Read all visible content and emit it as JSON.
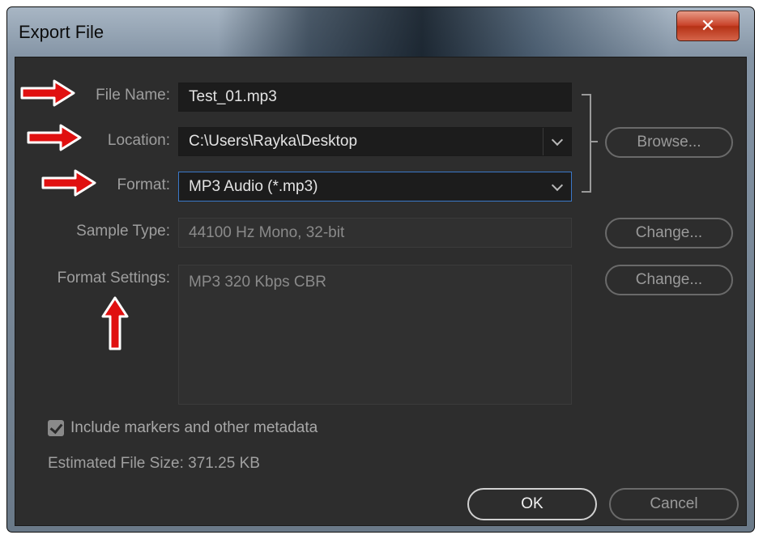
{
  "window": {
    "title": "Export File",
    "close_glyph": "✕"
  },
  "fields": {
    "file_name": {
      "label": "File Name:",
      "value": "Test_01.mp3"
    },
    "location": {
      "label": "Location:",
      "value": "C:\\Users\\Rayka\\Desktop"
    },
    "format": {
      "label": "Format:",
      "value": "MP3 Audio (*.mp3)"
    },
    "sample_type": {
      "label": "Sample Type:",
      "value": "44100 Hz Mono, 32-bit"
    },
    "format_settings": {
      "label": "Format Settings:",
      "value": "MP3 320 Kbps CBR"
    }
  },
  "buttons": {
    "browse": "Browse...",
    "change_sample": "Change...",
    "change_format": "Change...",
    "ok": "OK",
    "cancel": "Cancel"
  },
  "options": {
    "include_markers_label": "Include markers and other metadata",
    "include_markers_checked": true
  },
  "estimated_size": "Estimated File Size: 371.25 KB",
  "annotations": {
    "arrow_color": "#e01010",
    "arrow_icon": "red-arrow-icon"
  },
  "colors": {
    "dialog_bg": "#2d2d2d",
    "field_bg": "#1c1c1c",
    "focus_border": "#3a78c8"
  }
}
